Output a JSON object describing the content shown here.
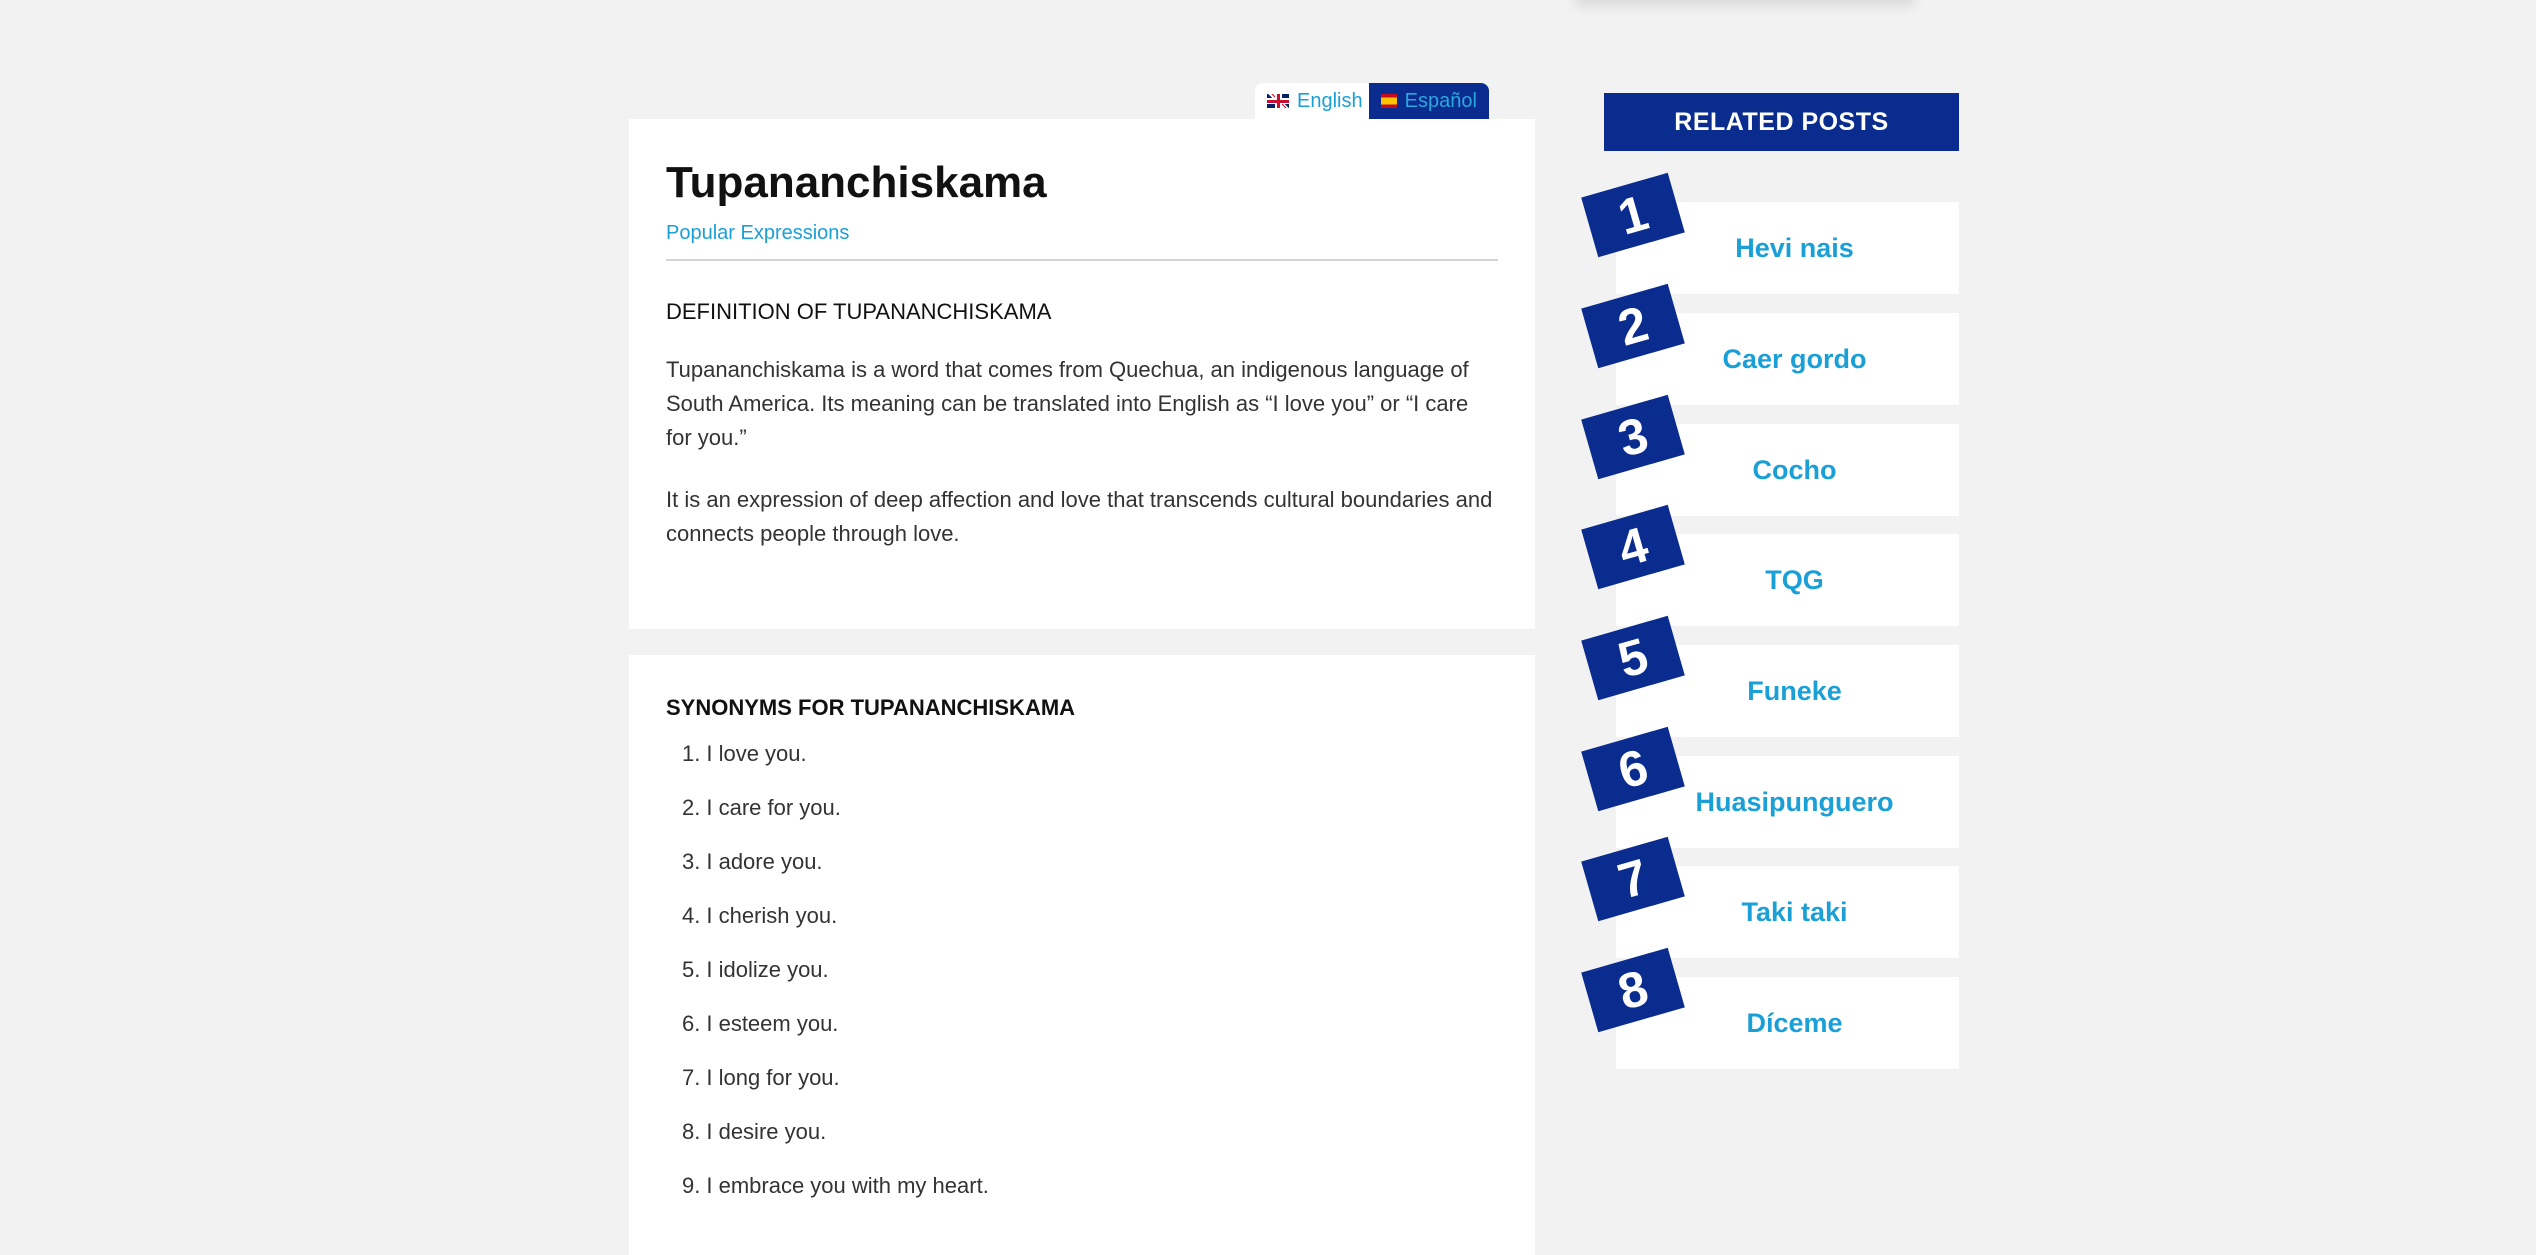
{
  "language_switcher": {
    "english_label": "English",
    "spanish_label": "Español"
  },
  "post": {
    "title": "Tupananchiskama",
    "category": "Popular Expressions",
    "definition_heading": "DEFINITION OF TUPANANCHISKAMA",
    "paragraphs": [
      "Tupananchiskama is a word that comes from Quechua, an indigenous language of South America. Its meaning can be translated into English as “I love you” or “I care for you.”",
      "It is an expression of deep affection and love that transcends cultural boundaries and connects people through love."
    ]
  },
  "synonyms": {
    "heading": "SYNONYMS FOR TUPANANCHISKAMA",
    "items": [
      {
        "num": "1.",
        "text": "I love you."
      },
      {
        "num": "2.",
        "text": "I care for you."
      },
      {
        "num": "3.",
        "text": "I adore you."
      },
      {
        "num": "4.",
        "text": "I cherish you."
      },
      {
        "num": "5.",
        "text": "I idolize you."
      },
      {
        "num": "6.",
        "text": "I esteem you."
      },
      {
        "num": "7.",
        "text": "I long for you."
      },
      {
        "num": "8.",
        "text": "I desire you."
      },
      {
        "num": "9.",
        "text": "I embrace you with my heart."
      }
    ]
  },
  "related": {
    "heading": "RELATED POSTS",
    "items": [
      {
        "num": "1",
        "label": "Hevi nais"
      },
      {
        "num": "2",
        "label": "Caer gordo"
      },
      {
        "num": "3",
        "label": "Cocho"
      },
      {
        "num": "4",
        "label": "TQG"
      },
      {
        "num": "5",
        "label": "Funeke"
      },
      {
        "num": "6",
        "label": "Huasipunguero"
      },
      {
        "num": "7",
        "label": "Taki taki"
      },
      {
        "num": "8",
        "label": "Díceme"
      }
    ]
  },
  "colors": {
    "brand_blue": "#0a2c8f",
    "link_blue": "#1a9fd6",
    "page_bg": "#f2f2f2"
  }
}
